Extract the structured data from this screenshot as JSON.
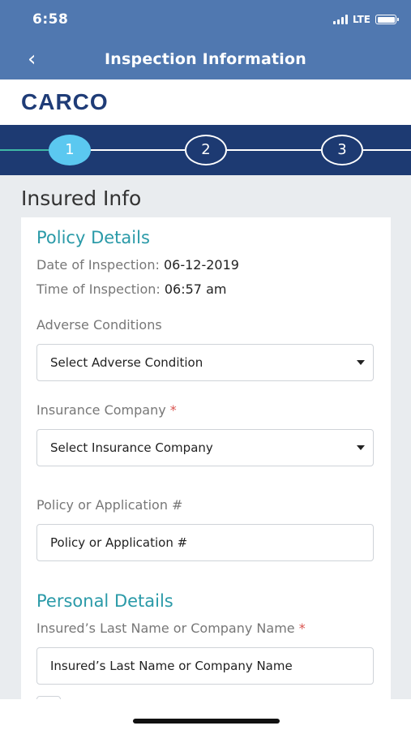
{
  "status": {
    "time": "6:58",
    "network": "LTE"
  },
  "nav": {
    "back_icon": "chevron-left-icon",
    "title": "Inspection Information"
  },
  "brand": {
    "logo": "CARCO"
  },
  "stepper": {
    "steps": [
      "1",
      "2",
      "3"
    ],
    "active": "1"
  },
  "page": {
    "heading": "Insured Info"
  },
  "policy_details": {
    "title": "Policy Details",
    "date_label": "Date of Inspection:",
    "date_value": "06-12-2019",
    "time_label": "Time of Inspection:",
    "time_value": "06:57 am",
    "adverse_label": "Adverse Conditions",
    "adverse_select": "Select Adverse Condition",
    "insurance_label": "Insurance Company",
    "required_mark": "*",
    "insurance_select": "Select Insurance Company",
    "policy_label": "Policy or Application #",
    "policy_placeholder": "Policy or Application #"
  },
  "personal_details": {
    "title": "Personal Details",
    "last_name_label": "Insured’s Last Name or Company Name",
    "required_mark": "*",
    "last_name_placeholder": "Insured’s Last Name or Company Name"
  },
  "colors": {
    "header": "#5078b0",
    "stepper": "#1d3a72",
    "accent": "#2a9aa8",
    "active_step": "#5bc8f0",
    "required": "#d9534f"
  }
}
